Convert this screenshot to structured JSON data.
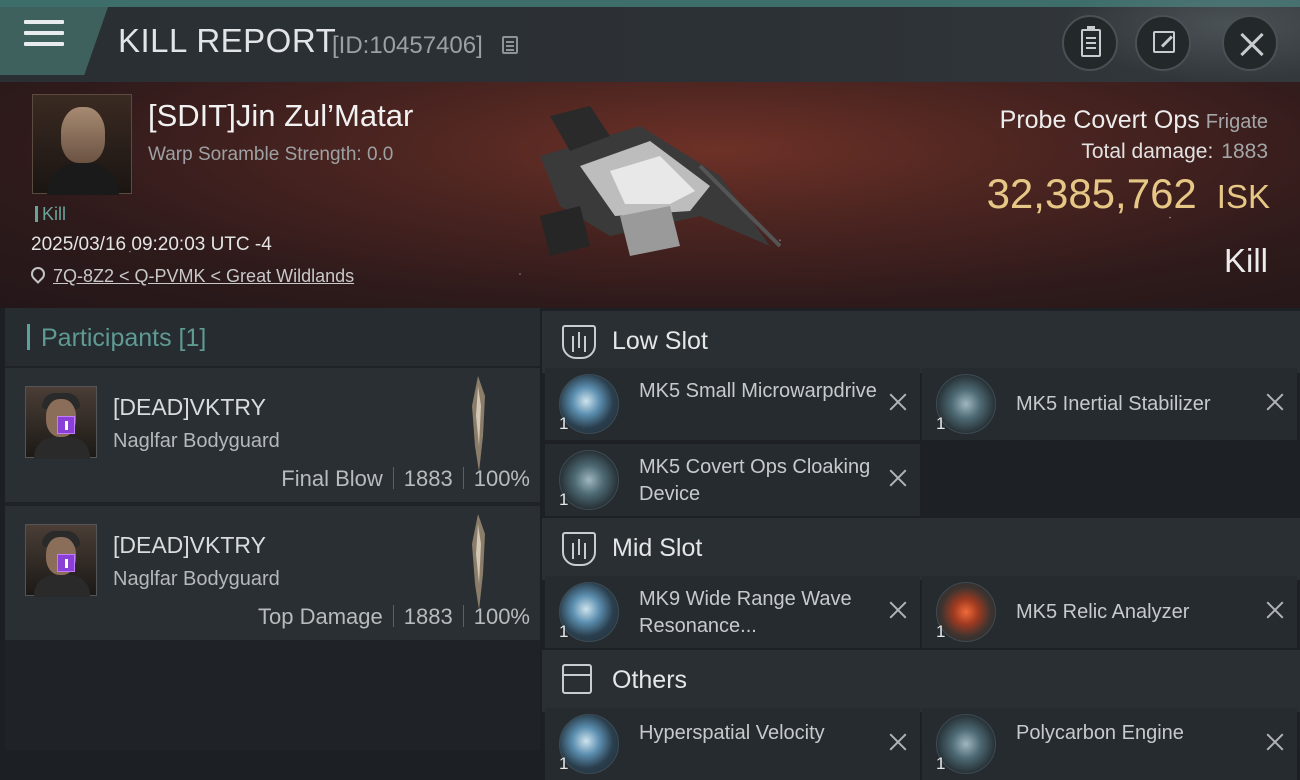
{
  "header": {
    "title": "KILL REPORT",
    "report_id": "[ID:10457406]",
    "menu_icon": "hamburger-menu-icon",
    "buttons": {
      "clipboard": "clipboard-icon",
      "share": "share-icon",
      "close": "close-icon"
    }
  },
  "victim": {
    "name": "[SDIT]Jin Zul’Matar",
    "warp_scramble": "Warp Soramble Strength: 0.0",
    "tag": "Kill",
    "datetime": "2025/03/16 09:20:03 UTC -4",
    "location": "7Q-8Z2 < Q-PVMK < Great Wildlands"
  },
  "ship": {
    "name": "Probe Covert Ops",
    "class": "Frigate",
    "total_damage_label": "Total damage:",
    "total_damage": "1883",
    "isk_value": "32,385,762",
    "isk_unit": "ISK",
    "result": "Kill"
  },
  "participants": {
    "header": "Participants [1]",
    "items": [
      {
        "name": "[DEAD]VKTRY",
        "ship": "Naglfar Bodyguard",
        "role": "Final Blow",
        "damage": "1883",
        "percent": "100%"
      },
      {
        "name": "[DEAD]VKTRY",
        "ship": "Naglfar Bodyguard",
        "role": "Top Damage",
        "damage": "1883",
        "percent": "100%"
      }
    ]
  },
  "slots": {
    "low": {
      "title": "Low Slot",
      "modules": [
        {
          "qty": "1",
          "name": "MK5 Small Microwarpdrive"
        },
        {
          "qty": "1",
          "name": "MK5 Inertial Stabilizer"
        },
        {
          "qty": "1",
          "name": "MK5 Covert Ops Cloaking Device"
        }
      ]
    },
    "mid": {
      "title": "Mid Slot",
      "modules": [
        {
          "qty": "1",
          "name": "MK9 Wide Range Wave Resonance..."
        },
        {
          "qty": "1",
          "name": "MK5 Relic Analyzer"
        }
      ]
    },
    "others": {
      "title": "Others",
      "modules": [
        {
          "qty": "1",
          "name": "Hyperspatial Velocity"
        },
        {
          "qty": "1",
          "name": "Polycarbon Engine"
        }
      ]
    }
  },
  "colors": {
    "accent": "#3d6e6a",
    "isk": "#e7c786",
    "badge": "#8a3fd6"
  }
}
